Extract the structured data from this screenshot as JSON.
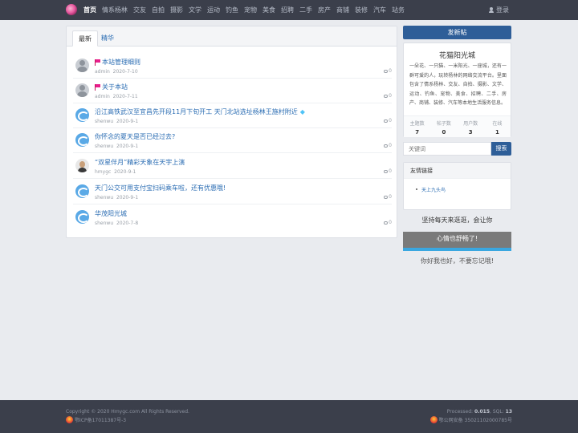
{
  "nav": {
    "items": [
      "首页",
      "情系杨林",
      "交友",
      "自拍",
      "摄影",
      "文学",
      "运动",
      "钓鱼",
      "宠物",
      "美食",
      "招聘",
      "二手",
      "房产",
      "商铺",
      "装修",
      "汽车",
      "站务"
    ],
    "login_label": "登录"
  },
  "tabs": [
    "最新",
    "精华"
  ],
  "threads": [
    {
      "title": "本站管理细则",
      "author": "admin",
      "date": "2020-7-10",
      "replies": "0",
      "avatar": "gray",
      "sticky": true,
      "gem": false
    },
    {
      "title": "关于本站",
      "author": "admin",
      "date": "2020-7-11",
      "replies": "0",
      "avatar": "gray",
      "sticky": true,
      "gem": false
    },
    {
      "title": "沿江高铁武汉至宜昌先开段11月下旬开工 天门北站选址杨林王施村附近",
      "author": "shenwu",
      "date": "2020-9-1",
      "replies": "0",
      "avatar": "blue",
      "sticky": false,
      "gem": true
    },
    {
      "title": "你怀念的夏天是否已经过去?",
      "author": "shenwu",
      "date": "2020-9-1",
      "replies": "0",
      "avatar": "blue",
      "sticky": false,
      "gem": false
    },
    {
      "title": "“双星伴月”精彩天象在天宇上演",
      "author": "hmygc",
      "date": "2020-9-1",
      "replies": "0",
      "avatar": "photo",
      "sticky": false,
      "gem": false
    },
    {
      "title": "天门公交可用支付宝扫码乘车啦，还有优惠哦!",
      "author": "shenwu",
      "date": "2020-9-1",
      "replies": "0",
      "avatar": "blue",
      "sticky": false,
      "gem": false
    },
    {
      "title": "华茂阳光城",
      "author": "shenwu",
      "date": "2020-7-8",
      "replies": "0",
      "avatar": "blue",
      "sticky": false,
      "gem": false
    }
  ],
  "sidebar": {
    "post_button": "发新帖",
    "site_name": "花猫阳光城",
    "site_desc": "一朵花、一只猫、一米阳光、一座城，还有一群可爱的人，玩转杨林的网络交流平台。里面包含了情系杨林、交友、自拍、摄影、文学、运动、钓鱼、宠物、美食、招聘、二手、房产、商铺、装修、汽车等本地生活服务信息。",
    "stats": [
      {
        "label": "主题数",
        "value": "7"
      },
      {
        "label": "帖子数",
        "value": "0"
      },
      {
        "label": "用户数",
        "value": "3"
      },
      {
        "label": "在线",
        "value": "1"
      }
    ],
    "search_placeholder": "关键词",
    "search_button": "搜索",
    "links_title": "友情链接",
    "links": [
      "天上九头鸟"
    ],
    "slogan1": "坚持每天来逛逛，会让你",
    "slogan_bar": "心情也舒畅了!",
    "slogan2": "你好我也好，不要忘记哦!"
  },
  "footer": {
    "copyright": "Copyright © 2020 Hmygc.com All Rights Reserved.",
    "icp": "鄂ICP备17011387号-3",
    "processed_label": "Processed:",
    "processed_value": "0.015",
    "sql_label": ", SQL:",
    "sql_value": "13",
    "police": "鄂公网安备 35021102000785号"
  }
}
